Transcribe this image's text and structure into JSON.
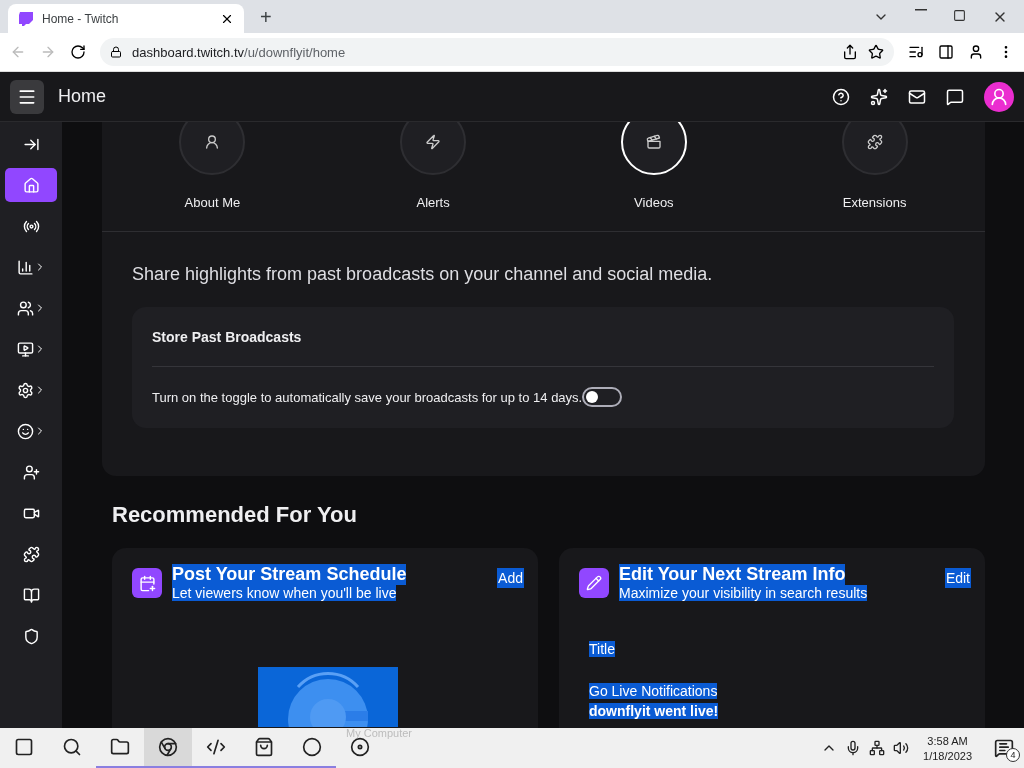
{
  "browser": {
    "tab_title": "Home - Twitch",
    "new_tab": "+",
    "url_domain": "dashboard.twitch.tv",
    "url_path": "/u/downflyit/home"
  },
  "topbar": {
    "title": "Home"
  },
  "sidebar": {
    "items": [
      {
        "selected": false,
        "expandable": false
      },
      {
        "selected": true,
        "expandable": false
      },
      {
        "selected": false,
        "expandable": false
      },
      {
        "selected": false,
        "expandable": true
      },
      {
        "selected": false,
        "expandable": true
      },
      {
        "selected": false,
        "expandable": true
      },
      {
        "selected": false,
        "expandable": true
      },
      {
        "selected": false,
        "expandable": true
      },
      {
        "selected": false,
        "expandable": false
      },
      {
        "selected": false,
        "expandable": false
      },
      {
        "selected": false,
        "expandable": false
      },
      {
        "selected": false,
        "expandable": false
      },
      {
        "selected": false,
        "expandable": false
      }
    ]
  },
  "tiles": [
    {
      "label": "About Me",
      "selected": false
    },
    {
      "label": "Alerts",
      "selected": false
    },
    {
      "label": "Videos",
      "selected": true
    },
    {
      "label": "Extensions",
      "selected": false
    }
  ],
  "videos_panel": {
    "description": "Share highlights from past broadcasts on your channel and social media.",
    "setting": {
      "title": "Store Past Broadcasts",
      "text": "Turn on the toggle to automatically save your broadcasts for up to 14 days.",
      "on": false
    }
  },
  "recommended": {
    "heading": "Recommended For You",
    "cards": [
      {
        "kind": "schedule",
        "title": "Post Your Stream Schedule",
        "subtitle": "Let viewers know when you'll be live",
        "action": "Add",
        "highlighted": true
      },
      {
        "kind": "info",
        "title": "Edit Your Next Stream Info",
        "subtitle": "Maximize your visibility in search results",
        "action": "Edit",
        "highlighted": true,
        "fields": [
          "Title",
          "Go Live Notifications"
        ],
        "notification": "downflyit went live!"
      }
    ]
  },
  "drag_ghost": "My Computer",
  "taskbar": {
    "apps": [
      {
        "selected": false,
        "running": false
      },
      {
        "selected": false,
        "running": false
      },
      {
        "selected": false,
        "running": true
      },
      {
        "selected": true,
        "running": true
      },
      {
        "selected": false,
        "running": true
      },
      {
        "selected": false,
        "running": true
      },
      {
        "selected": false,
        "running": true
      },
      {
        "selected": false,
        "running": false
      }
    ],
    "time": "3:58 AM",
    "date": "1/18/2023",
    "notifications": "4"
  }
}
